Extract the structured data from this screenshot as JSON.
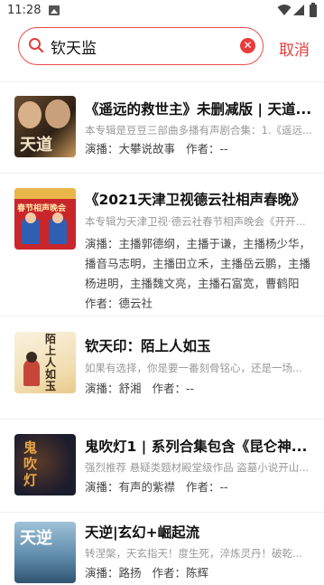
{
  "status": {
    "time": "11:28"
  },
  "search": {
    "query": "钦天监",
    "clear_label": "✕",
    "cancel_label": "取消"
  },
  "results": [
    {
      "title": "《遥远的救世主》未删减版 | 天道...",
      "desc": "本专辑是豆豆三部曲多播有声剧合集：1.《遥远...",
      "performer_label": "演播：",
      "performer": "大攀说故事",
      "author_label": "作者：",
      "author": "--",
      "cover_text": "天道",
      "cover_color": "#3a2a1e"
    },
    {
      "title": "《2021天津卫视德云社相声春晚》",
      "desc": "本专辑为天津卫视·德云社春节相声晚会《开开...",
      "performer_label": "演播：",
      "performer": "主播郭德纲，主播于谦，主播杨少华，播音马志明，主播田立禾，主播岳云鹏，主播杨进明，主播魏文亮，主播石富宽，曹鹤阳",
      "author_label": "作者：",
      "author": "德云社",
      "cover_text": "春节相声晚会",
      "cover_color": "#c8262b"
    },
    {
      "title": "钦天印：陌上人如玉",
      "desc": "如果有选择，你是要一番刻骨铭心，还是一场...",
      "performer_label": "演播：",
      "performer": "舒湘",
      "author_label": "作者：",
      "author": "--",
      "cover_text": "陌上人如玉",
      "cover_color": "#f3e6c8"
    },
    {
      "title": "鬼吹灯1 | 系列合集包含《昆仑神...",
      "desc": "强烈推荐 悬疑类题材殿堂级作品 盗墓小说开山...",
      "performer_label": "演播：",
      "performer": "有声的紫襟",
      "author_label": "作者：",
      "author": "--",
      "cover_text": "鬼吹灯",
      "cover_color": "#1b1c2c"
    },
    {
      "title": "天逆|玄幻+崛起流",
      "desc": "转涅槃，天玄指天！度生死，淬炼灵丹！破乾...",
      "performer_label": "演播：",
      "performer": "路扬",
      "author_label": "作者：",
      "author": "陈辉",
      "cover_text": "天逆",
      "cover_color": "#5b87a8"
    }
  ]
}
